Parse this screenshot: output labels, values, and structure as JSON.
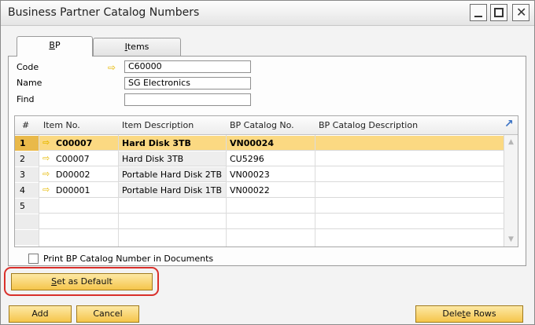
{
  "window": {
    "title": "Business Partner Catalog Numbers"
  },
  "tabs": [
    {
      "label": "BP",
      "underline": "B",
      "rest": "P",
      "active": true
    },
    {
      "label": "Items",
      "underline": "I",
      "rest": "tems",
      "active": false
    }
  ],
  "fields": {
    "code": {
      "label": "Code",
      "value": "C60000"
    },
    "name": {
      "label": "Name",
      "value": "SG Electronics"
    },
    "find": {
      "label": "Find",
      "value": ""
    }
  },
  "grid": {
    "columns": [
      "#",
      "Item No.",
      "Item Description",
      "BP Catalog No.",
      "BP Catalog Description"
    ],
    "rows": [
      {
        "num": "1",
        "item_no": "C00007",
        "description": "Hard Disk 3TB",
        "bp_catalog_no": "VN00024",
        "bp_catalog_desc": "",
        "selected": true
      },
      {
        "num": "2",
        "item_no": "C00007",
        "description": "Hard Disk 3TB",
        "bp_catalog_no": "CU5296",
        "bp_catalog_desc": "",
        "selected": false
      },
      {
        "num": "3",
        "item_no": "D00002",
        "description": "Portable Hard Disk 2TB",
        "bp_catalog_no": "VN00023",
        "bp_catalog_desc": "",
        "selected": false
      },
      {
        "num": "4",
        "item_no": "D00001",
        "description": "Portable Hard Disk 1TB",
        "bp_catalog_no": "VN00022",
        "bp_catalog_desc": "",
        "selected": false
      },
      {
        "num": "5",
        "item_no": "",
        "description": "",
        "bp_catalog_no": "",
        "bp_catalog_desc": "",
        "selected": false
      }
    ]
  },
  "checkbox": {
    "label": "Print BP Catalog Number in Documents",
    "checked": false
  },
  "buttons": {
    "set_default": {
      "label": "Set as Default",
      "underline": "S",
      "rest": "et as Default"
    },
    "add": {
      "label": "Add"
    },
    "cancel": {
      "label": "Cancel"
    },
    "delete_rows": {
      "label": "Delete Rows",
      "prefix": "Dele",
      "underline": "t",
      "suffix": "e Rows"
    }
  },
  "colors": {
    "selected_row": "#fbd982",
    "button": "#f5c54b",
    "highlight_ring": "#d9302b",
    "link_arrow": "#e6b800"
  },
  "icons": [
    "link-arrow-icon",
    "expand-icon",
    "scroll-up-icon",
    "scroll-down-icon",
    "minimize-icon",
    "maximize-icon",
    "close-icon"
  ]
}
